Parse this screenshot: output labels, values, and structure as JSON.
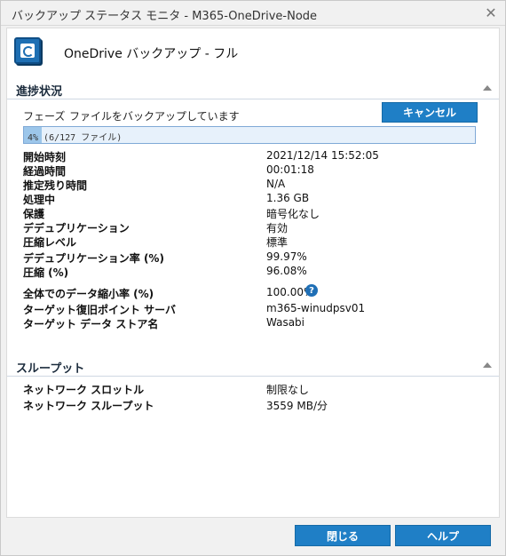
{
  "window": {
    "title": "バックアップ ステータス モニタ - M365-OneDrive-Node",
    "close_icon": "close-icon"
  },
  "header": {
    "title": "OneDrive バックアップ - フル",
    "icon": "backup-app-icon"
  },
  "progress_section": {
    "title": "進捗状況",
    "phase_label": "フェーズ",
    "phase_value": "ファイルをバックアップしています",
    "cancel_label": "キャンセル",
    "progress": {
      "text": "4% (6/127 ファイル)",
      "percent": 4
    },
    "rows": [
      {
        "label": "開始時刻",
        "value": "2021/12/14 15:52:05"
      },
      {
        "label": "経過時間",
        "value": "00:01:18"
      },
      {
        "label": "推定残り時間",
        "value": "N/A"
      },
      {
        "label": "処理中",
        "value": "1.36 GB"
      },
      {
        "label": "保護",
        "value": "暗号化なし"
      },
      {
        "label": "デデュプリケーション",
        "value": "有効"
      },
      {
        "label": "圧縮レベル",
        "value": "標準"
      },
      {
        "label": "デデュプリケーション率 (%)",
        "value": "99.97%"
      },
      {
        "label": "圧縮 (%)",
        "value": "96.08%"
      },
      {
        "label": "全体でのデータ縮小率 (%)",
        "value": "100.00%"
      },
      {
        "label": "ターゲット復旧ポイント サーバ",
        "value": "m365-winudpsv01"
      },
      {
        "label": "ターゲット データ ストア名",
        "value": "Wasabi"
      }
    ]
  },
  "throughput_section": {
    "title": "スループット",
    "rows": [
      {
        "label": "ネットワーク スロットル",
        "value": "制限なし"
      },
      {
        "label": "ネットワーク スループット",
        "value": "3559 MB/分"
      }
    ]
  },
  "footer": {
    "close_label": "閉じる",
    "help_label": "ヘルプ"
  },
  "colors": {
    "accent": "#1f7fc6",
    "progress_fill": "#9cc6ea",
    "progress_bg": "#e7f1fb"
  }
}
